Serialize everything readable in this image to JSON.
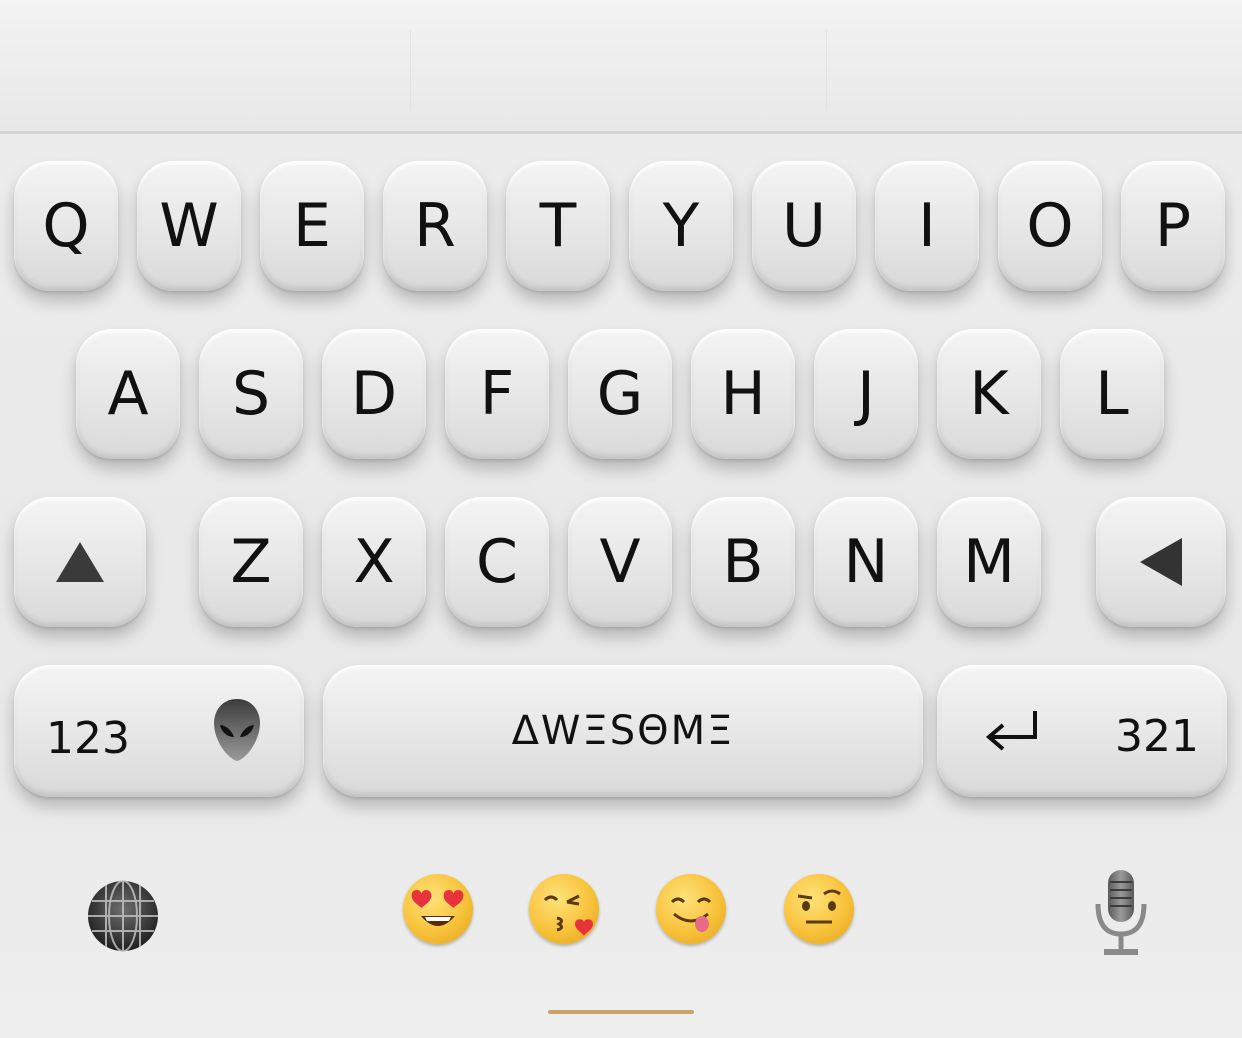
{
  "keyboard": {
    "row1": [
      "Q",
      "W",
      "E",
      "R",
      "T",
      "Y",
      "U",
      "I",
      "O",
      "P"
    ],
    "row2": [
      "A",
      "S",
      "D",
      "F",
      "G",
      "H",
      "J",
      "K",
      "L"
    ],
    "row3": [
      "Z",
      "X",
      "C",
      "V",
      "B",
      "N",
      "M"
    ],
    "numbers_label": "123",
    "space_label": "ΔWΞSΘMΞ",
    "reverse_numbers_label": "321",
    "icons": {
      "shift": "shift-up-triangle-icon",
      "backspace": "backspace-left-triangle-icon",
      "alien": "alien-head-icon",
      "return": "return-arrow-icon"
    }
  },
  "bottom_bar": {
    "icons": [
      "globe-icon",
      "heart-eyes-emoji",
      "kissing-heart-emoji",
      "yum-emoji",
      "raised-eyebrow-emoji",
      "microphone-icon"
    ]
  },
  "colors": {
    "key_face": "#e6e6e6",
    "background": "#ececec",
    "key_text": "#111111",
    "home_indicator": "#c9a36a"
  }
}
